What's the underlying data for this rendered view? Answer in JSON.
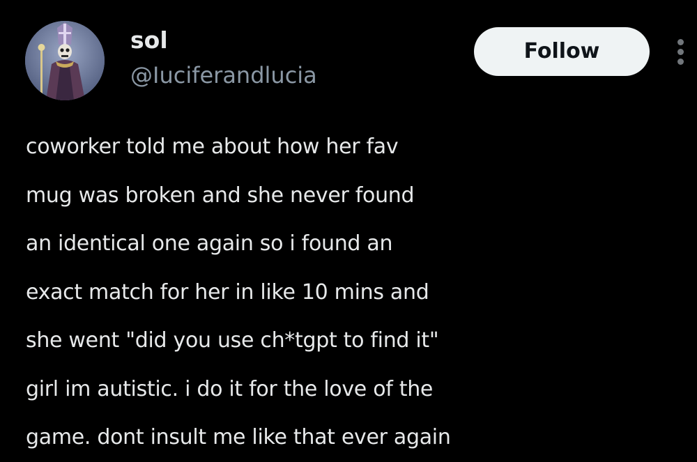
{
  "author": {
    "display_name": "sol",
    "handle": "@Iuciferandlucia",
    "avatar_icon": "ornate-figure-avatar"
  },
  "actions": {
    "follow_label": "Follow",
    "more_icon": "more-vertical-icon"
  },
  "tweet": {
    "lines": [
      "coworker told me about how her fav",
      "mug was broken and she never found",
      "an identical one again so i found an",
      "exact match for her in like 10 mins and",
      "she went \"did you use ch*tgpt to find it\"",
      "girl im autistic. i do it for the love of the",
      "game. dont insult me like that ever again"
    ]
  },
  "colors": {
    "background": "#000000",
    "primary_text": "#e7e9ea",
    "secondary_text": "#8b98a5",
    "follow_bg": "#eff3f4",
    "follow_text": "#0f1419"
  }
}
